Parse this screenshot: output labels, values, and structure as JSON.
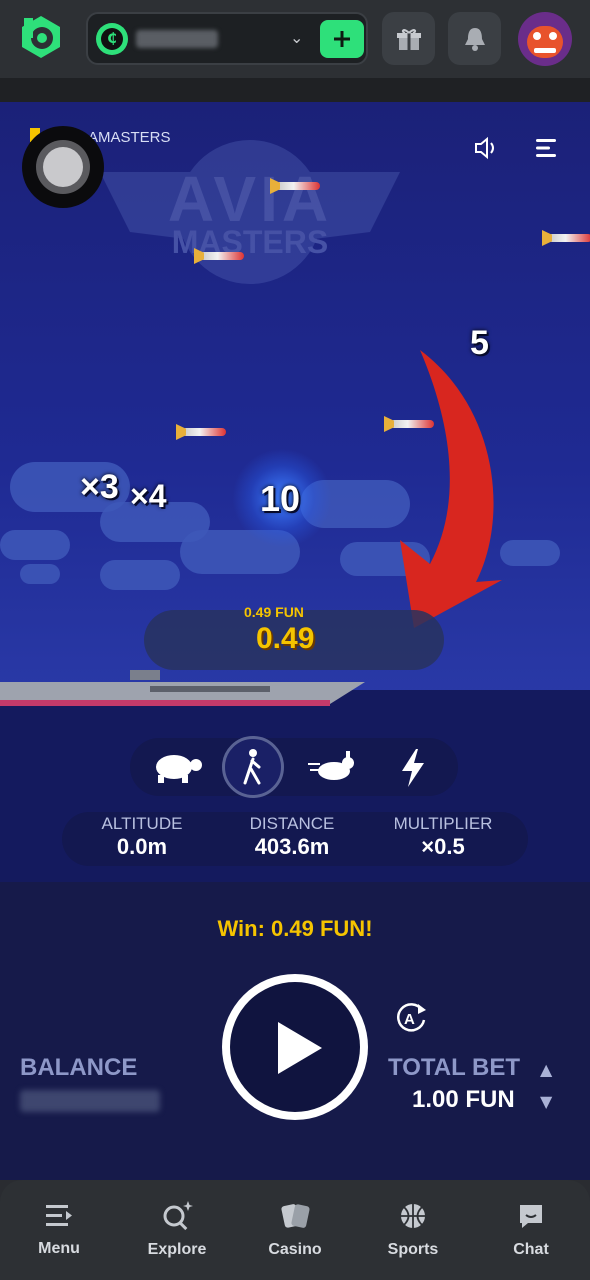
{
  "header": {
    "logo_icon": "bc-game-logo",
    "wallet": {
      "currency_icon": "bcd-coin-icon",
      "balance_masked": "••••• •.••"
    },
    "deposit_icon": "plus-icon",
    "gift_icon": "gift-icon",
    "notification_icon": "bell-icon",
    "avatar_icon": "dragon-avatar"
  },
  "game": {
    "title_line1": "AVIA",
    "title_line2": "MASTERS",
    "corner_label": "AMASTERS",
    "sound_icon": "speaker-icon",
    "menu_icon": "hamburger-icon",
    "multipliers": [
      "5",
      "×3",
      "×4",
      "10"
    ],
    "float_win_small": "0.49 FUN",
    "float_win_big": "0.49",
    "speeds": [
      {
        "name": "turtle-icon",
        "active": false
      },
      {
        "name": "walking-icon",
        "active": true
      },
      {
        "name": "rabbit-icon",
        "active": false
      },
      {
        "name": "lightning-icon",
        "active": false
      }
    ],
    "stats": {
      "altitude_label": "ALTITUDE",
      "altitude_value": "0.0m",
      "distance_label": "DISTANCE",
      "distance_value": "403.6m",
      "multiplier_label": "MULTIPLIER",
      "multiplier_value": "×0.5"
    }
  },
  "controls": {
    "win_text": "Win: 0.49 FUN!",
    "balance_label": "BALANCE",
    "balance_masked": "••••• •.•• •••",
    "total_bet_label": "TOTAL BET",
    "total_bet_value": "1.00 FUN",
    "play_icon": "play-icon",
    "auto_icon": "autoplay-icon"
  },
  "nav": [
    {
      "label": "Menu",
      "icon": "menu-icon"
    },
    {
      "label": "Explore",
      "icon": "search-sparkle-icon"
    },
    {
      "label": "Casino",
      "icon": "cards-icon"
    },
    {
      "label": "Sports",
      "icon": "basketball-icon"
    },
    {
      "label": "Chat",
      "icon": "chat-icon"
    }
  ],
  "colors": {
    "accent_green": "#2ee07a",
    "win_yellow": "#f5c400",
    "arrow_red": "#d8261f",
    "game_bg": "#1d2477"
  }
}
